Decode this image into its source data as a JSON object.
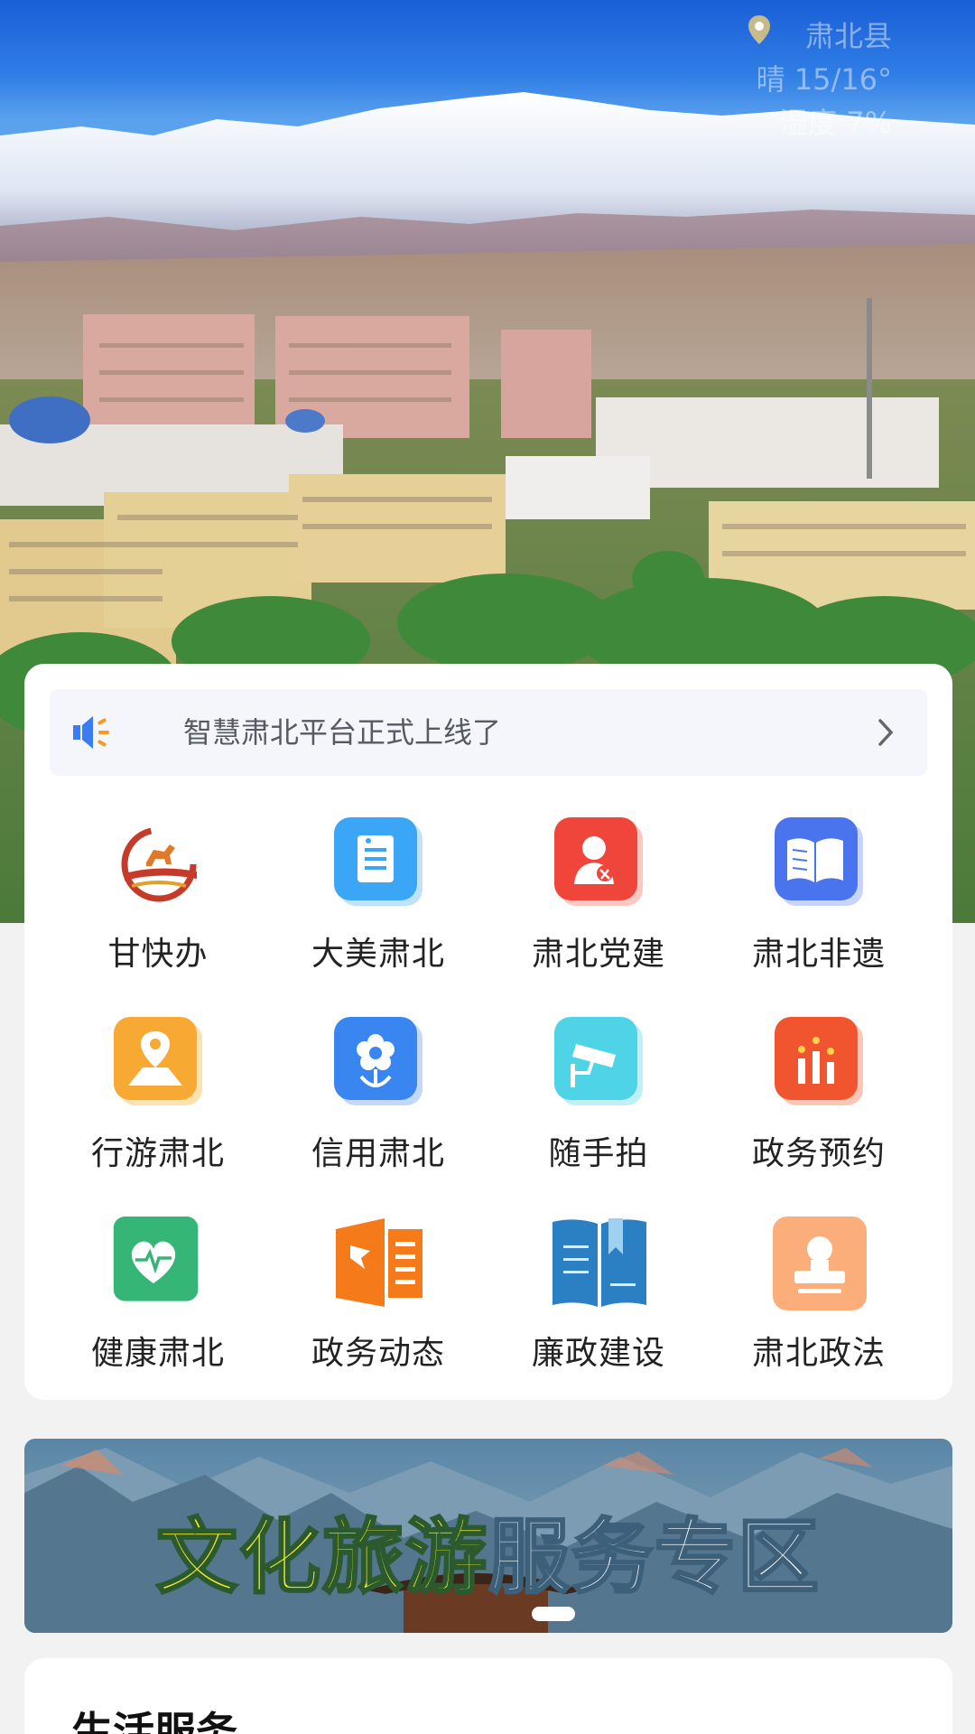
{
  "location": {
    "county": "肃北县",
    "line2": "晴 15/16°",
    "line3": "湿度 7%"
  },
  "notice": {
    "text": "智慧肃北平台正式上线了",
    "icon": "speaker-icon",
    "arrow": "chevron-right-icon"
  },
  "services": [
    {
      "label": "甘快办",
      "icon": "horse-logo-icon"
    },
    {
      "label": "大美肃北",
      "icon": "document-icon"
    },
    {
      "label": "肃北党建",
      "icon": "party-icon"
    },
    {
      "label": "肃北非遗",
      "icon": "book-icon"
    },
    {
      "label": "行游肃北",
      "icon": "map-pin-icon"
    },
    {
      "label": "信用肃北",
      "icon": "flower-icon"
    },
    {
      "label": "随手拍",
      "icon": "camera-icon"
    },
    {
      "label": "政务预约",
      "icon": "chart-stars-icon"
    },
    {
      "label": "健康肃北",
      "icon": "heartbeat-icon"
    },
    {
      "label": "政务动态",
      "icon": "flag-news-icon"
    },
    {
      "label": "廉政建设",
      "icon": "open-book-icon"
    },
    {
      "label": "肃北政法",
      "icon": "stamp-icon"
    }
  ],
  "banner": {
    "title_part1": "文化旅游",
    "title_part2": "服务专区"
  },
  "life": {
    "title": "生活服务"
  },
  "colors": {
    "accent_blue": "#3b7cf5",
    "card_bg": "#ffffff",
    "page_bg": "#f2f2f2"
  }
}
